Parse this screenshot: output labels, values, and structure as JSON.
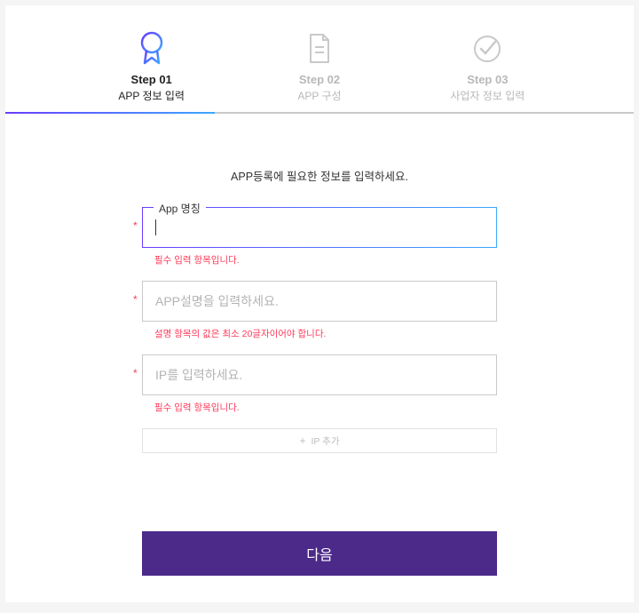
{
  "steps": [
    {
      "title": "Step 01",
      "sub": "APP 정보 입력"
    },
    {
      "title": "Step 02",
      "sub": "APP 구성"
    },
    {
      "title": "Step 03",
      "sub": "사업자 정보 입력"
    }
  ],
  "intro": "APP등록에 필요한 정보를 입력하세요.",
  "fields": {
    "appName": {
      "label": "App 명칭",
      "value": "",
      "error": "필수 입력 항목입니다."
    },
    "appDesc": {
      "placeholder": "APP설명을 입력하세요.",
      "error": "설명 항목의 값은 최소 20글자이어야 합니다."
    },
    "ip": {
      "placeholder": "IP를 입력하세요.",
      "error": "필수 입력 항목입니다."
    }
  },
  "addIpLabel": "IP 추가",
  "nextLabel": "다음",
  "colors": {
    "gradientStart": "#6a3cff",
    "gradientEnd": "#3ba8ff",
    "primaryButton": "#4b2a8a",
    "error": "#ff3a5a"
  }
}
